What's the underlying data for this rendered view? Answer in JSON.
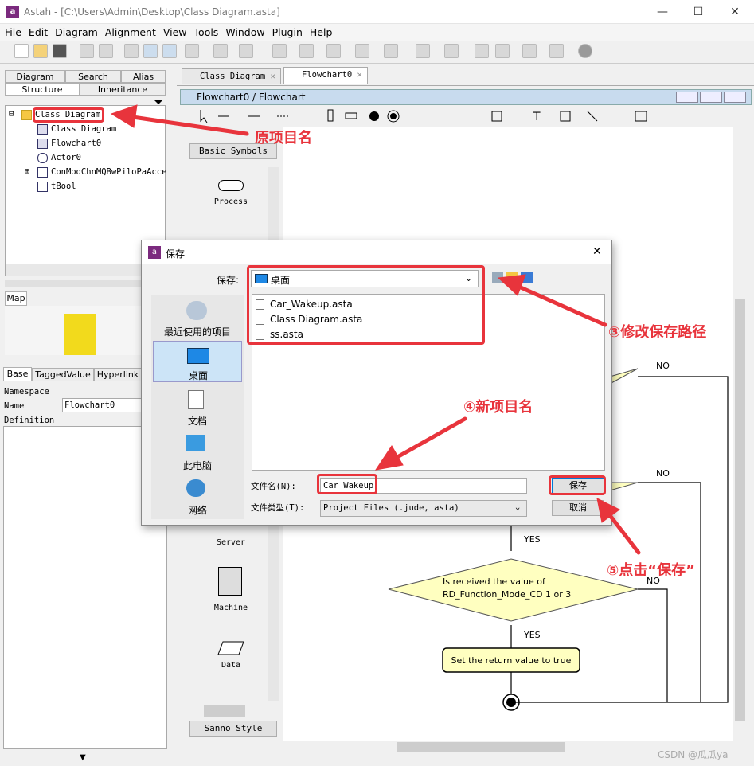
{
  "window": {
    "title": "Astah - [C:\\Users\\Admin\\Desktop\\Class Diagram.asta]",
    "minimize": "—",
    "maximize": "☐",
    "close": "✕"
  },
  "menu": [
    "File",
    "Edit",
    "Diagram",
    "Alignment",
    "View",
    "Tools",
    "Window",
    "Plugin",
    "Help"
  ],
  "left_tabs": {
    "row1": [
      "Diagram",
      "Search",
      "Alias"
    ],
    "row2": [
      "Structure",
      "Inheritance"
    ]
  },
  "tree": [
    {
      "label": "Class Diagram",
      "icon": "project-icon"
    },
    {
      "label": "Class Diagram",
      "icon": "class-diagram-icon"
    },
    {
      "label": "Flowchart0",
      "icon": "flowchart-icon"
    },
    {
      "label": "Actor0",
      "icon": "actor-icon"
    },
    {
      "label": "ConModChnMQBwPiloPaAcce",
      "icon": "class-icon"
    },
    {
      "label": "tBool",
      "icon": "class-icon"
    }
  ],
  "map_tab": "Map",
  "prop_tabs": [
    "Base",
    "TaggedValue",
    "Hyperlink"
  ],
  "props": {
    "namespace_label": "Namespace",
    "name_label": "Name",
    "name_value": "Flowchart0",
    "definition_label": "Definition"
  },
  "doc_tabs": [
    "Class Diagram",
    "Flowchart0"
  ],
  "inner_title": "Flowchart0 / Flowchart",
  "palette": {
    "header": "Basic Symbols",
    "items": [
      "Process",
      "Server",
      "Machine",
      "Data"
    ],
    "footer": "Sanno Style"
  },
  "flow": {
    "no1": "NO",
    "no2": "NO",
    "no3": "NO",
    "yes1": "YES",
    "yes2": "YES",
    "decision_line1": "Is received the value of",
    "decision_line2": "RD_Function_Mode_CD 1 or 3",
    "process": "Set the return value to true"
  },
  "dialog": {
    "title": "保存",
    "save_in_label": "保存:",
    "save_in_value": "桌面",
    "places": [
      "最近使用的项目",
      "桌面",
      "文档",
      "此电脑",
      "网络"
    ],
    "files": [
      "Car_Wakeup.asta",
      "Class Diagram.asta",
      "ss.asta"
    ],
    "filename_label": "文件名(N):",
    "filename_value": "Car_Wakeup",
    "filetype_label": "文件类型(T):",
    "filetype_value": "Project Files  (.jude, asta)",
    "save_button": "保存",
    "cancel_button": "取消",
    "close": "✕"
  },
  "annotations": {
    "orig_name": "原项目名",
    "change_path": "③修改保存路径",
    "new_name": "④新项目名",
    "click_save": "⑤点击“保存”"
  },
  "watermark": "CSDN @瓜瓜ya",
  "colors": {
    "annotation": "#e8343c",
    "decision_fill": "#ffffc0",
    "accent": "#7b2a7e"
  }
}
